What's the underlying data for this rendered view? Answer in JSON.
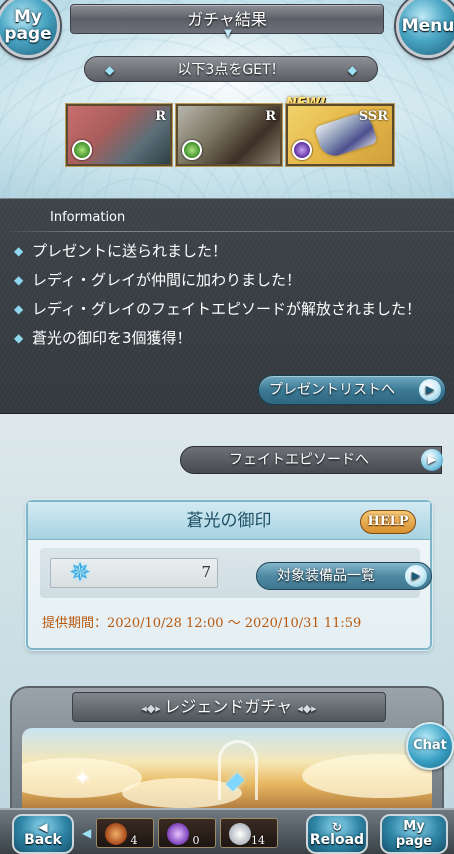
{
  "header": {
    "title": "ガチャ結果",
    "mypage_line1": "My",
    "mypage_line2": "page",
    "menu_label": "Menu"
  },
  "results": {
    "banner": "以下3点をGET！",
    "new_label": "NEW!",
    "cards": [
      {
        "rarity": "R",
        "element": "wind"
      },
      {
        "rarity": "R",
        "element": "wind"
      },
      {
        "rarity": "SSR",
        "element": "dark"
      }
    ]
  },
  "information": {
    "title": "Information",
    "items": [
      "プレゼントに送られました！",
      "レディ・グレイが仲間に加わりました！",
      "レディ・グレイのフェイトエピソードが解放されました！",
      "蒼光の御印を3個獲得！"
    ],
    "present_button": "プレゼントリストへ"
  },
  "fate_episode_button": "フェイトエピソードへ",
  "seal": {
    "title": "蒼光の御印",
    "help_label": "HELP",
    "count": "7",
    "equip_button": "対象装備品一覧",
    "period": "提供期間：2020/10/28 12:00 ～ 2020/10/31 11:59"
  },
  "legend": {
    "title": "レジェンドガチャ"
  },
  "chat_label": "Chat",
  "bottom_nav": {
    "back_label": "Back",
    "reload_label": "Reload",
    "mypage_line1": "My",
    "mypage_line2": "page",
    "items": [
      {
        "icon": "sword-item-icon",
        "count": "4"
      },
      {
        "icon": "wand-item-icon",
        "count": "0"
      },
      {
        "icon": "orb-item-icon",
        "count": "14"
      }
    ]
  },
  "colors": {
    "accent_blue": "#3d7a95",
    "period_orange": "#b8580d",
    "help_orange": "#d8902e"
  }
}
